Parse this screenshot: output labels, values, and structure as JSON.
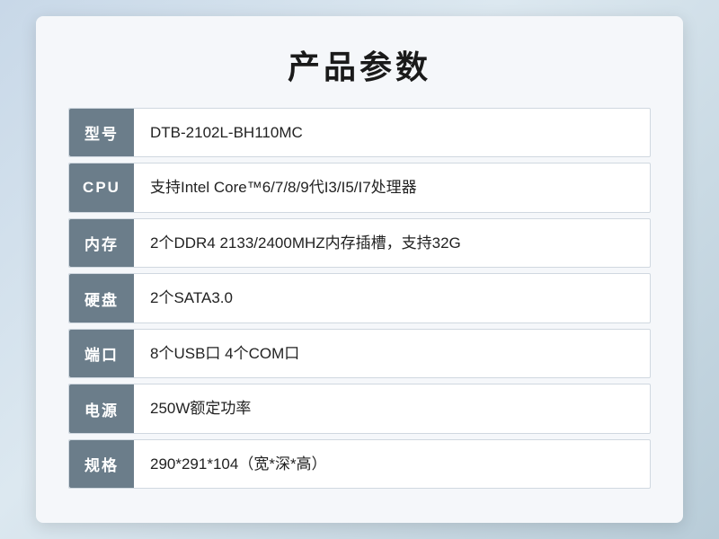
{
  "page": {
    "title": "产品参数",
    "specs": [
      {
        "label": "型号",
        "value": "DTB-2102L-BH110MC"
      },
      {
        "label": "CPU",
        "value": "支持Intel Core™6/7/8/9代I3/I5/I7处理器"
      },
      {
        "label": "内存",
        "value": "2个DDR4 2133/2400MHZ内存插槽，支持32G"
      },
      {
        "label": "硬盘",
        "value": "2个SATA3.0"
      },
      {
        "label": "端口",
        "value": "8个USB口 4个COM口"
      },
      {
        "label": "电源",
        "value": "250W额定功率"
      },
      {
        "label": "规格",
        "value": "290*291*104（宽*深*高）"
      }
    ]
  }
}
